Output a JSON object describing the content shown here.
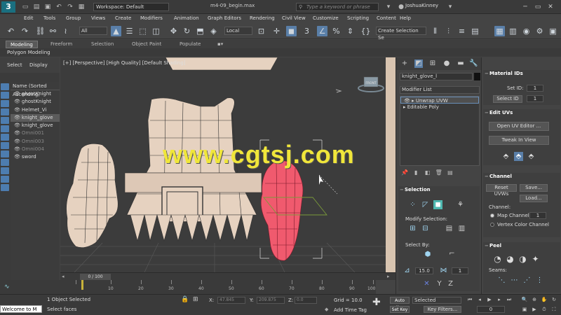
{
  "app": {
    "logo": "3",
    "workspace": "Workspace: Default",
    "file_title": "m4-09_begin.max",
    "search_placeholder": "Type a keyword or phrase",
    "user": "JoshuaKinney"
  },
  "menu": [
    "Edit",
    "Tools",
    "Group",
    "Views",
    "Create",
    "Modifiers",
    "Animation",
    "Graph Editors",
    "Rendering",
    "Civil View",
    "Customize",
    "Scripting",
    "Content",
    "Help"
  ],
  "toolbar": {
    "filter": "All",
    "coord_system": "Local",
    "selection_set": "Create Selection Se"
  },
  "ribbon": {
    "tabs": [
      "Modeling",
      "Freeform",
      "Selection",
      "Object Paint",
      "Populate"
    ],
    "sub_label": "Polygon Modeling"
  },
  "scene": {
    "tabs": [
      "Select",
      "Display"
    ],
    "header": "Name (Sorted Ascending)",
    "items": [
      {
        "name": "ghostKnight",
        "dim": false,
        "selected": false
      },
      {
        "name": "ghostKnight",
        "dim": false,
        "selected": false
      },
      {
        "name": "Helmet_Vi",
        "dim": false,
        "selected": false
      },
      {
        "name": "knight_glove",
        "dim": false,
        "selected": true
      },
      {
        "name": "knight_glove",
        "dim": false,
        "selected": false
      },
      {
        "name": "Omni001",
        "dim": true,
        "selected": false
      },
      {
        "name": "Omni003",
        "dim": true,
        "selected": false
      },
      {
        "name": "Omni004",
        "dim": true,
        "selected": false
      },
      {
        "name": "sword",
        "dim": false,
        "selected": false
      }
    ]
  },
  "viewport": {
    "label": "[+] [Perspective] [High Quality] [Default Shading]",
    "watermark": "www.cgtsj.com",
    "cube_label": "FRONT"
  },
  "timeline": {
    "frame": "0 / 100",
    "ticks": [
      "10",
      "20",
      "30",
      "40",
      "50",
      "60",
      "70",
      "80",
      "90",
      "100"
    ]
  },
  "command_panel": {
    "object_name": "knight_glove_l",
    "modifier_list": "Modifier List",
    "stack": [
      {
        "label": "Unwrap UVW",
        "selected": true
      },
      {
        "label": "Editable Poly",
        "selected": false
      }
    ],
    "selection": {
      "title": "Selection",
      "modify_label": "Modify Selection:",
      "select_by_label": "Select By:",
      "angle": "15.0",
      "count": "1"
    }
  },
  "right_panel": {
    "material_ids": {
      "title": "Material IDs",
      "set_id_label": "Set ID:",
      "set_id_value": "1",
      "select_id_label": "Select ID",
      "select_id_value": "1"
    },
    "edit_uvs": {
      "title": "Edit UVs",
      "open_uv_editor": "Open UV Editor ...",
      "tweak_in_view": "Tweak In View"
    },
    "channel": {
      "title": "Channel",
      "reset_uvws": "Reset UVWs",
      "save": "Save...",
      "load": "Load...",
      "channel_label": "Channel:",
      "map_channel_label": "Map Channel:",
      "map_channel_value": "1",
      "vertex_color_label": "Vertex Color Channel"
    },
    "peel": {
      "title": "Peel",
      "seams_label": "Seams:"
    }
  },
  "status": {
    "listener": "Welcome to M",
    "objects_selected": "1 Object Selected",
    "prompt": "Select faces",
    "x_label": "X:",
    "x_value": "47.845",
    "y_label": "Y:",
    "y_value": "209.875",
    "z_label": "Z:",
    "z_value": "0.0",
    "grid": "Grid = 10.0",
    "add_time_tag": "Add Time Tag",
    "auto_key": "Auto Key",
    "set_key": "Set Key",
    "key_mode": "Selected",
    "key_filters": "Key Filters...",
    "frame_value": "0"
  },
  "colors": {
    "accent": "#5a7fa8",
    "selected_glove": "#f05a6e",
    "model_base": "#e6d2c0",
    "watermark": "#f0e63a"
  }
}
